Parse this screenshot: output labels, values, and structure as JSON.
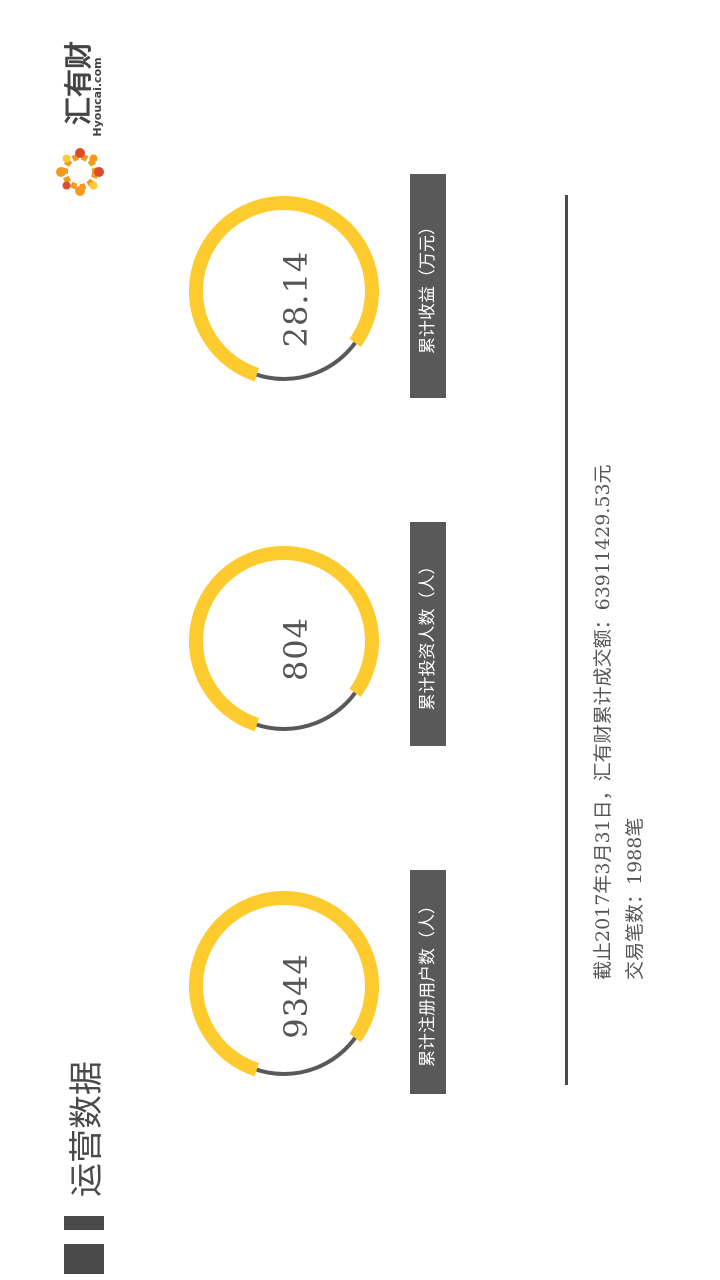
{
  "brand": {
    "name": "汇有财",
    "domain": "Hyoucai.com",
    "colors": {
      "accent": "#FECB2F",
      "dark": "#595959",
      "logo_orange": "#F39A1E",
      "logo_red": "#E04A2A"
    }
  },
  "page": {
    "title": "运营数据"
  },
  "stats": [
    {
      "value": "28.14",
      "label": "累计收益（万元）",
      "fill_fraction": 0.8
    },
    {
      "value": "804",
      "label": "累计投资人数（人）",
      "fill_fraction": 0.8
    },
    {
      "value": "9344",
      "label": "累计注册用户数（人）",
      "fill_fraction": 0.8
    }
  ],
  "summary": {
    "line1": "截止2017年3月31日，汇有财累计成交额：63911429.53元",
    "line2": "交易笔数：1988笔"
  }
}
